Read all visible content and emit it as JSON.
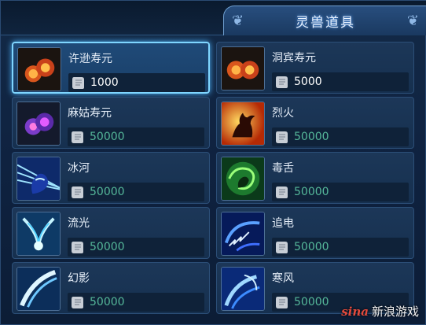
{
  "header": {
    "title": "灵兽道具"
  },
  "items": [
    {
      "name": "许逊寿元",
      "price": "1000",
      "icon": "twin-fire-orbs-icon",
      "price_color": "white"
    },
    {
      "name": "洞宾寿元",
      "price": "5000",
      "icon": "twin-fire-orbs-icon",
      "price_color": "white"
    },
    {
      "name": "麻姑寿元",
      "price": "50000",
      "icon": "twin-purple-orbs-icon",
      "price_color": "green"
    },
    {
      "name": "烈火",
      "price": "50000",
      "icon": "fire-claw-icon",
      "price_color": "green"
    },
    {
      "name": "冰河",
      "price": "50000",
      "icon": "ice-claw-icon",
      "price_color": "green"
    },
    {
      "name": "毒舌",
      "price": "50000",
      "icon": "poison-swirl-icon",
      "price_color": "green"
    },
    {
      "name": "流光",
      "price": "50000",
      "icon": "light-streak-icon",
      "price_color": "green"
    },
    {
      "name": "追电",
      "price": "50000",
      "icon": "lightning-ring-icon",
      "price_color": "green"
    },
    {
      "name": "幻影",
      "price": "50000",
      "icon": "phantom-slash-icon",
      "price_color": "green"
    },
    {
      "name": "寒风",
      "price": "50000",
      "icon": "cold-wind-icon",
      "price_color": "green"
    }
  ],
  "watermark": {
    "logo": "sina",
    "text": "新浪游戏"
  },
  "colors": {
    "panel_bg": "#132a47",
    "card_border": "#2c4f78",
    "selected_glow": "#7fd6ff",
    "price_green": "#55b89a",
    "price_white": "#ffffff"
  }
}
